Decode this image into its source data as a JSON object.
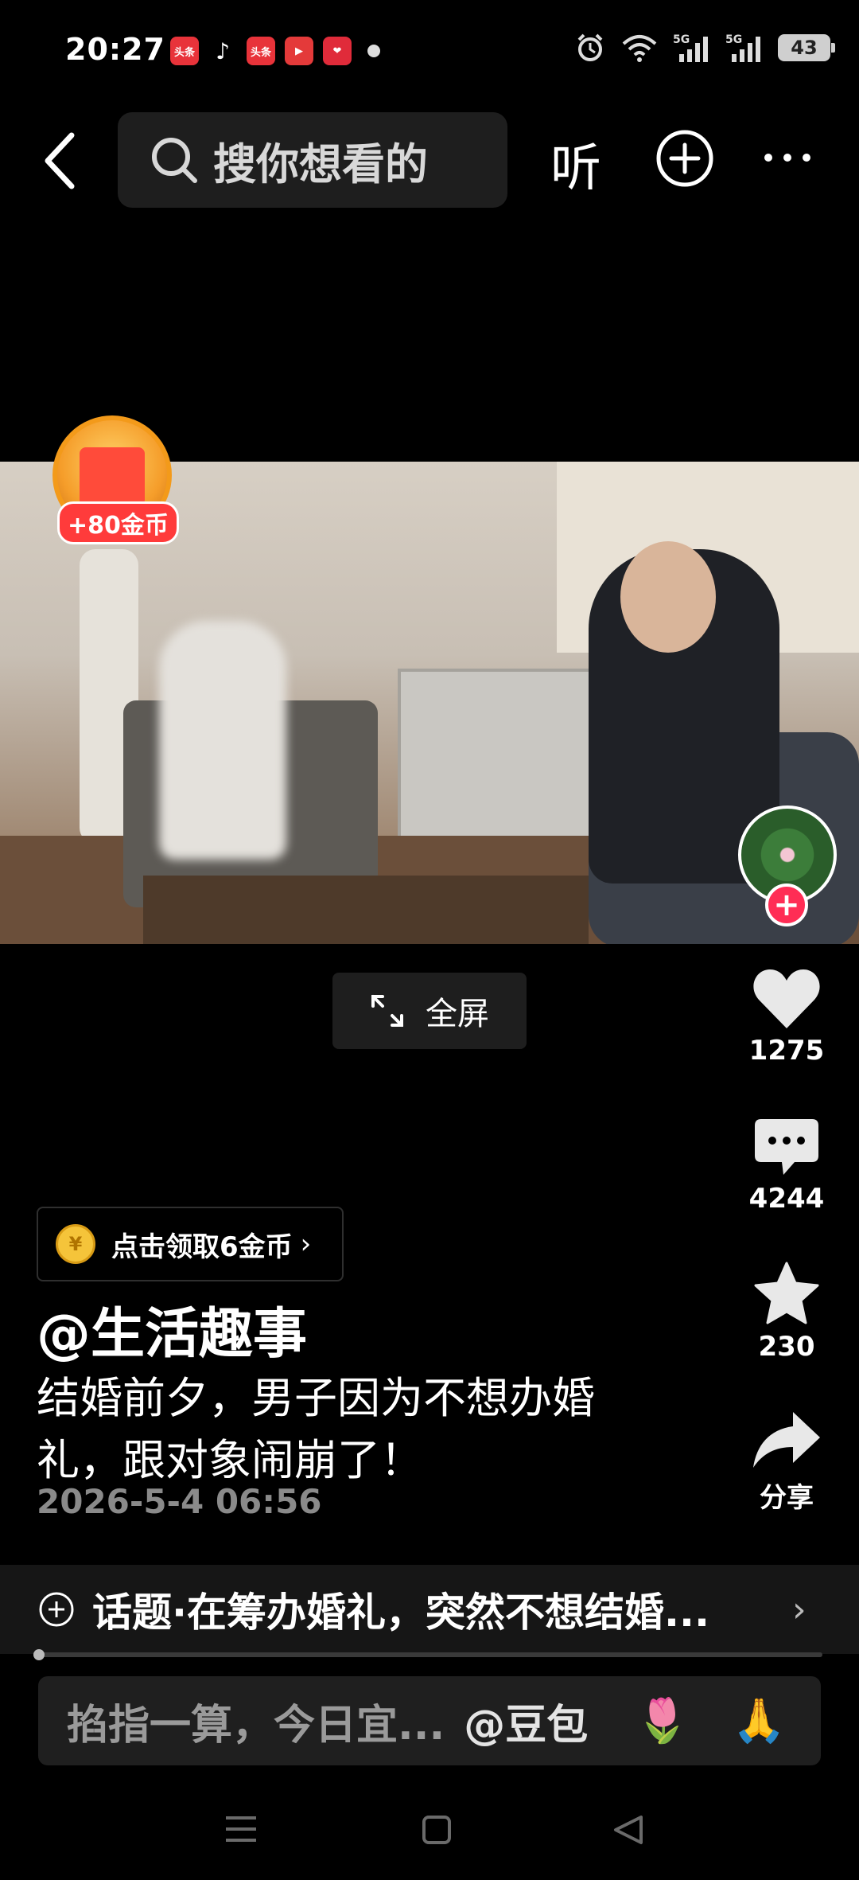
{
  "status": {
    "time": "20:27",
    "app_icons": [
      "头条",
      "tiktok",
      "头条",
      "play",
      "heart"
    ],
    "signal": [
      "5G",
      "5G"
    ],
    "battery": "43"
  },
  "topbar": {
    "search_placeholder": "搜你想看的",
    "listen_label": "听"
  },
  "video": {
    "coin_badge": "+80金币",
    "fullscreen_label": "全屏"
  },
  "actions": {
    "likes": "1275",
    "comments": "4244",
    "favorites": "230",
    "share_label": "分享"
  },
  "post": {
    "reward_label": "点击领取6金币",
    "reward_coin_glyph": "¥",
    "author": "@生活趣事",
    "description": "结婚前夕，男子因为不想办婚礼，跟对象闹崩了！",
    "date": "2026-5-4 06:56"
  },
  "topic": {
    "label": "话题·在筹办婚礼，突然不想结婚..."
  },
  "ask": {
    "placeholder": "掐指一算，今日宜...",
    "mention": "@豆包",
    "emoji_1": "🌷",
    "emoji_2": "🙏"
  },
  "colors": {
    "accent": "#ff2d55",
    "coin_orange": "#f39a1a",
    "background": "#000000"
  }
}
